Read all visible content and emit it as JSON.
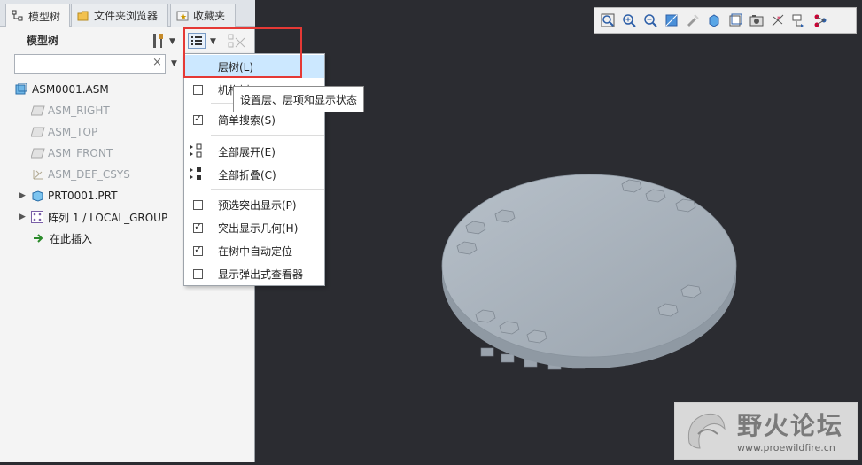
{
  "tabs": [
    {
      "label": "模型树",
      "icon": "model-tree-icon",
      "active": true
    },
    {
      "label": "文件夹浏览器",
      "icon": "folder-browser-icon",
      "active": false
    },
    {
      "label": "收藏夹",
      "icon": "favorites-icon",
      "active": false
    }
  ],
  "tree": {
    "title": "模型树",
    "search_value": "",
    "items": [
      {
        "label": "ASM0001.ASM",
        "icon": "assembly-icon",
        "dim": false,
        "expander": false
      },
      {
        "label": "ASM_RIGHT",
        "icon": "datum-plane-icon",
        "dim": true,
        "expander": false
      },
      {
        "label": "ASM_TOP",
        "icon": "datum-plane-icon",
        "dim": true,
        "expander": false
      },
      {
        "label": "ASM_FRONT",
        "icon": "datum-plane-icon",
        "dim": true,
        "expander": false
      },
      {
        "label": "ASM_DEF_CSYS",
        "icon": "csys-icon",
        "dim": true,
        "expander": false
      },
      {
        "label": "PRT0001.PRT",
        "icon": "part-icon",
        "dim": false,
        "expander": true
      },
      {
        "label": "阵列 1 / LOCAL_GROUP",
        "icon": "pattern-icon",
        "dim": false,
        "expander": true
      },
      {
        "label": "在此插入",
        "icon": "insert-here-icon",
        "dim": false,
        "expander": false
      }
    ]
  },
  "menu": {
    "items": [
      {
        "label": "层树(L)",
        "type": "highlight",
        "checked": false
      },
      {
        "label": "机构树",
        "type": "check",
        "checked": false
      },
      {
        "label": "简单搜索(S)",
        "type": "check",
        "checked": true
      },
      {
        "label": "全部展开(E)",
        "type": "icon",
        "icon": "expand-all-icon"
      },
      {
        "label": "全部折叠(C)",
        "type": "icon",
        "icon": "collapse-all-icon"
      },
      {
        "label": "预选突出显示(P)",
        "type": "check",
        "checked": false
      },
      {
        "label": "突出显示几何(H)",
        "type": "check",
        "checked": true
      },
      {
        "label": "在树中自动定位",
        "type": "check",
        "checked": true
      },
      {
        "label": "显示弹出式查看器",
        "type": "check",
        "checked": false
      }
    ],
    "tooltip": "设置层、层项和显示状态"
  },
  "view_toolbar": [
    "zoom-fit-icon",
    "zoom-in-icon",
    "zoom-out-icon",
    "refit-icon",
    "repaint-icon",
    "display-style-icon",
    "saved-views-icon",
    "view-manager-icon",
    "spin-center-icon",
    "datum-display-icon",
    "annotation-icon"
  ],
  "watermark": {
    "title": "野火论坛",
    "url": "www.proewildfire.cn"
  },
  "colors": {
    "highlight": "#cce8ff",
    "accent_red": "#e53935",
    "model_gray": "#a9b2bb",
    "viewport_bg": "#2b2c31"
  }
}
